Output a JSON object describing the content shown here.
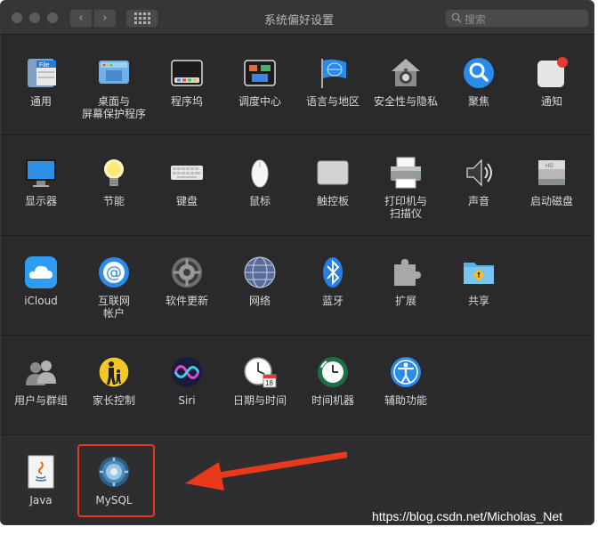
{
  "window": {
    "title": "系统偏好设置",
    "search_placeholder": "搜索",
    "nav_back": "‹",
    "nav_forward": "›"
  },
  "rows": [
    [
      {
        "name": "general",
        "label": "通用",
        "icon": "general-icon"
      },
      {
        "name": "desktop-screensaver",
        "label": "桌面与\n屏幕保护程序",
        "icon": "desktop-icon"
      },
      {
        "name": "dock",
        "label": "程序坞",
        "icon": "dock-icon"
      },
      {
        "name": "mission-control",
        "label": "调度中心",
        "icon": "mission-control-icon"
      },
      {
        "name": "language-region",
        "label": "语言与地区",
        "icon": "globe-flag-icon"
      },
      {
        "name": "security-privacy",
        "label": "安全性与隐私",
        "icon": "house-lock-icon"
      },
      {
        "name": "spotlight",
        "label": "聚焦",
        "icon": "magnifier-icon"
      },
      {
        "name": "notifications",
        "label": "通知",
        "icon": "notification-icon"
      }
    ],
    [
      {
        "name": "displays",
        "label": "显示器",
        "icon": "display-icon"
      },
      {
        "name": "energy-saver",
        "label": "节能",
        "icon": "lightbulb-icon"
      },
      {
        "name": "keyboard",
        "label": "键盘",
        "icon": "keyboard-icon"
      },
      {
        "name": "mouse",
        "label": "鼠标",
        "icon": "mouse-icon"
      },
      {
        "name": "trackpad",
        "label": "触控板",
        "icon": "trackpad-icon"
      },
      {
        "name": "printers-scanners",
        "label": "打印机与\n扫描仪",
        "icon": "printer-icon"
      },
      {
        "name": "sound",
        "label": "声音",
        "icon": "speaker-icon"
      },
      {
        "name": "startup-disk",
        "label": "启动磁盘",
        "icon": "disk-icon"
      }
    ],
    [
      {
        "name": "icloud",
        "label": "iCloud",
        "icon": "cloud-icon"
      },
      {
        "name": "internet-accounts",
        "label": "互联网\n帐户",
        "icon": "at-sign-icon"
      },
      {
        "name": "software-update",
        "label": "软件更新",
        "icon": "gear-update-icon"
      },
      {
        "name": "network",
        "label": "网络",
        "icon": "network-globe-icon"
      },
      {
        "name": "bluetooth",
        "label": "蓝牙",
        "icon": "bluetooth-icon"
      },
      {
        "name": "extensions",
        "label": "扩展",
        "icon": "puzzle-icon"
      },
      {
        "name": "sharing",
        "label": "共享",
        "icon": "sharing-folder-icon"
      }
    ],
    [
      {
        "name": "users-groups",
        "label": "用户与群组",
        "icon": "users-icon"
      },
      {
        "name": "parental-controls",
        "label": "家长控制",
        "icon": "parental-icon"
      },
      {
        "name": "siri",
        "label": "Siri",
        "icon": "siri-icon"
      },
      {
        "name": "date-time",
        "label": "日期与时间",
        "icon": "clock-calendar-icon"
      },
      {
        "name": "time-machine",
        "label": "时间机器",
        "icon": "time-machine-icon"
      },
      {
        "name": "accessibility",
        "label": "辅助功能",
        "icon": "accessibility-icon"
      }
    ],
    [
      {
        "name": "java",
        "label": "Java",
        "icon": "java-icon"
      },
      {
        "name": "mysql",
        "label": "MySQL",
        "icon": "mysql-icon"
      }
    ]
  ],
  "watermark": "https://blog.csdn.net/Micholas_Net",
  "colors": {
    "window_bg": "#2a2a2c",
    "highlight": "#e83a1b"
  }
}
